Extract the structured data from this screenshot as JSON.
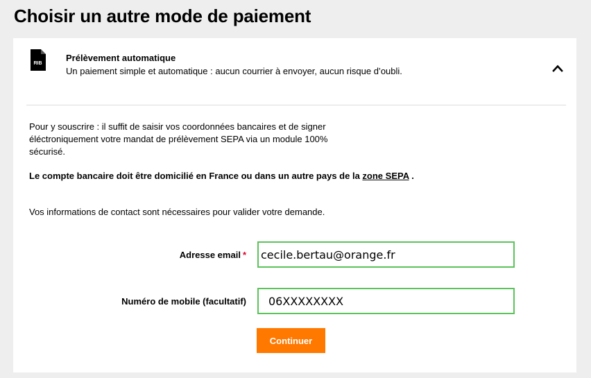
{
  "page": {
    "title": "Choisir un autre mode de paiement"
  },
  "payment_method": {
    "icon": "rib-document-icon",
    "icon_label": "RIB",
    "title": "Prélèvement automatique",
    "description": "Un paiement simple et automatique : aucun courrier à envoyer, aucun risque d’oubli.",
    "expanded": true,
    "toggle_icon": "chevron-up-icon"
  },
  "body": {
    "intro": "Pour y souscrire : il suffit de saisir vos coordonnées bancaires et de signer éléctroniquement votre mandat de prélèvement SEPA via un module 100% sécurisé.",
    "sepa_note_prefix": "Le compte bancaire doit être domicilié en France ou dans un autre pays de la ",
    "sepa_link": "zone SEPA",
    "sepa_note_suffix": " .",
    "contact_info": "Vos informations de contact sont nécessaires pour valider votre demande."
  },
  "form": {
    "email_label": "Adresse email",
    "required_marker": "*",
    "email_value": "cecile.bertau@orange.fr",
    "mobile_label": "Numéro de mobile (facultatif)",
    "mobile_value": "06XXXXXXXX",
    "submit_label": "Continuer"
  },
  "colors": {
    "background": "#eeeeee",
    "card": "#ffffff",
    "field_border_valid": "#5ac35a",
    "accent_orange": "#ff7900",
    "required_red": "#e0002a"
  }
}
